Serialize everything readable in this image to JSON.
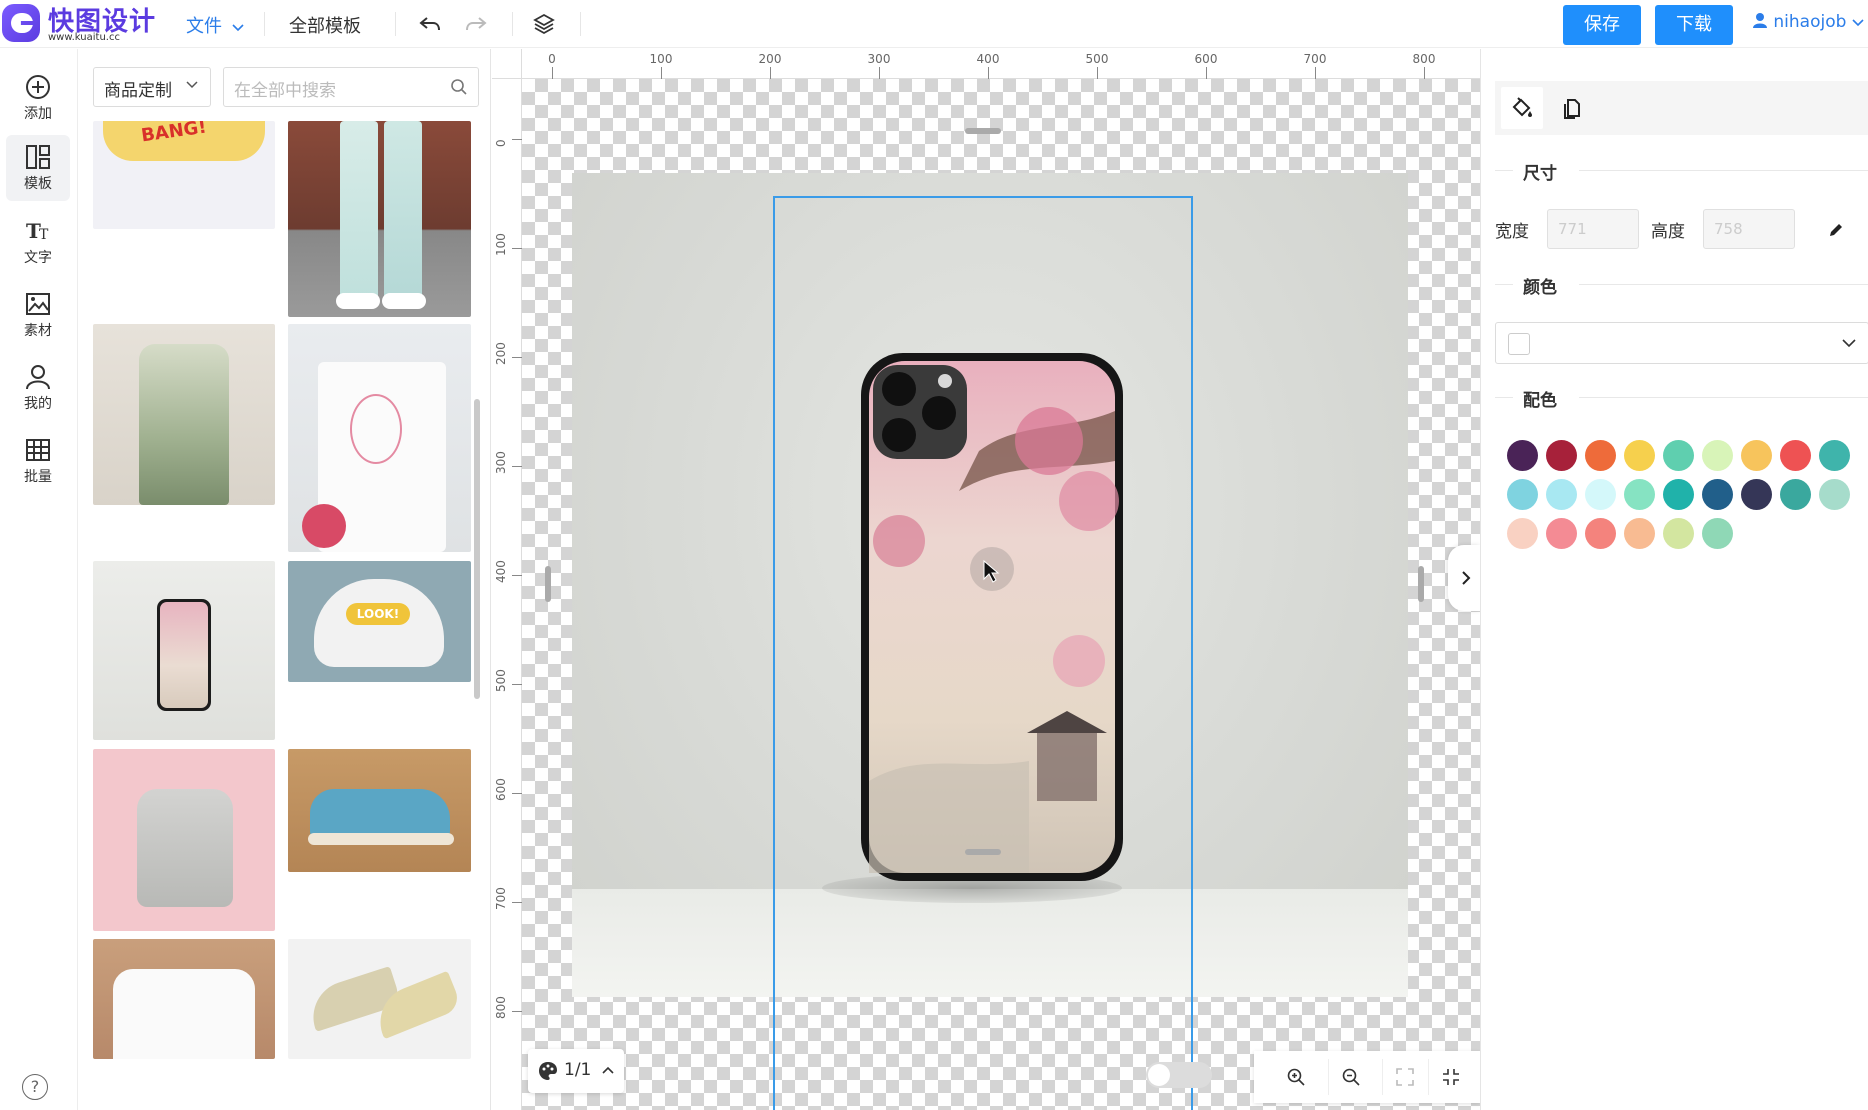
{
  "app": {
    "logo_name": "快图设计",
    "logo_url": "www.kuaitu.cc"
  },
  "toolbar": {
    "file_menu": "文件",
    "all_templates": "全部模板",
    "save_label": "保存",
    "download_label": "下载",
    "username": "nihaojob"
  },
  "rail": {
    "items": [
      {
        "label": "添加",
        "icon": "plus-circle-icon"
      },
      {
        "label": "模板",
        "icon": "template-icon"
      },
      {
        "label": "文字",
        "icon": "text-icon"
      },
      {
        "label": "素材",
        "icon": "image-icon"
      },
      {
        "label": "我的",
        "icon": "user-icon"
      },
      {
        "label": "批量",
        "icon": "table-icon"
      }
    ],
    "help": "?"
  },
  "panel": {
    "category": "商品定制",
    "search_placeholder": "在全部中搜索",
    "thumb_texts": {
      "mask_badge": "BANG!",
      "cap_badge": "LOOK!"
    }
  },
  "ruler": {
    "x_labels": [
      "0",
      "100",
      "200",
      "300",
      "400",
      "500",
      "600",
      "700",
      "800"
    ],
    "y_labels": [
      "0",
      "100",
      "200",
      "300",
      "400",
      "500",
      "600",
      "700",
      "800"
    ]
  },
  "canvas": {
    "page_indicator": "1/1"
  },
  "props": {
    "size_title": "尺寸",
    "width_label": "宽度",
    "width_value": "771",
    "height_label": "高度",
    "height_value": "758",
    "color_title": "颜色",
    "palette_title": "配色",
    "palette": [
      "#4a2357",
      "#a7213a",
      "#ee6b3a",
      "#f6d04d",
      "#5fcfaf",
      "#d8f4b8",
      "#f7c45c",
      "#ee5253",
      "#3fb4ab",
      "#7fd3e0",
      "#a8e8f2",
      "#d4f8fa",
      "#86e3c2",
      "#20b2aa",
      "#215f8a",
      "#353657",
      "#3aa89e",
      "#a6dccb",
      "#f9d1c2",
      "#f48b94",
      "#f4837d",
      "#f8bb92",
      "#d3e6a0",
      "#8fd8b6"
    ]
  }
}
